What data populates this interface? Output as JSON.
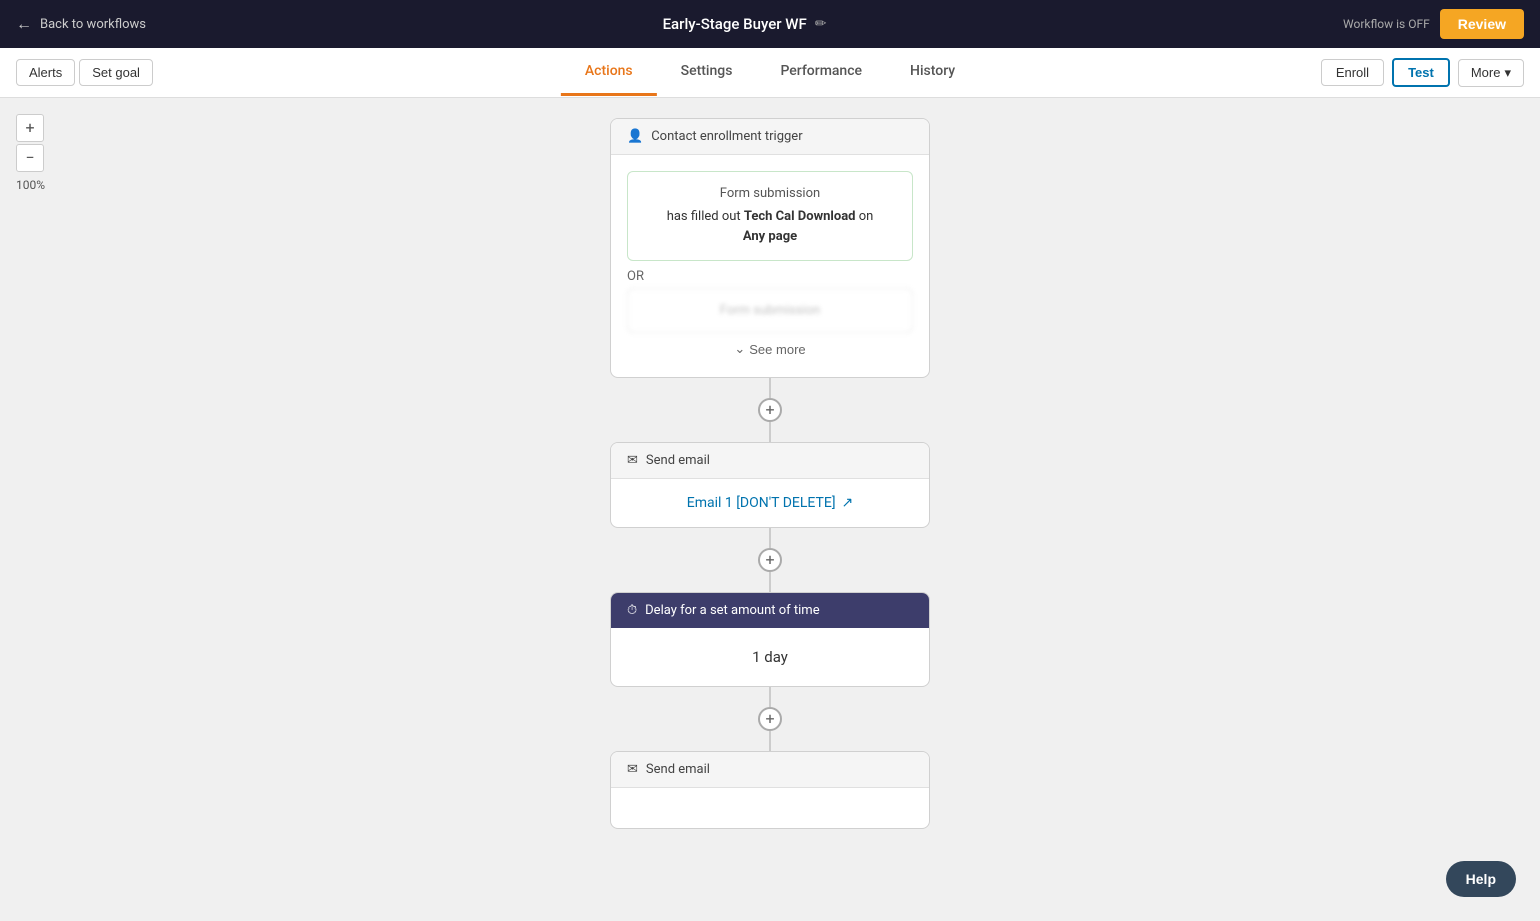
{
  "topbar": {
    "back_label": "Back to workflows",
    "workflow_name": "Early-Stage Buyer WF",
    "status": "Workflow is OFF",
    "review_label": "Review"
  },
  "navbar": {
    "alerts_label": "Alerts",
    "set_goal_label": "Set goal",
    "tabs": [
      {
        "id": "actions",
        "label": "Actions",
        "active": true
      },
      {
        "id": "settings",
        "label": "Settings",
        "active": false
      },
      {
        "id": "performance",
        "label": "Performance",
        "active": false
      },
      {
        "id": "history",
        "label": "History",
        "active": false
      }
    ],
    "enroll_label": "Enroll",
    "test_label": "Test",
    "more_label": "More"
  },
  "canvas": {
    "zoom_level": "100%",
    "zoom_in_label": "+",
    "zoom_out_label": "−"
  },
  "trigger_block": {
    "header": "Contact enrollment trigger",
    "form_submission": {
      "title": "Form submission",
      "desc_prefix": "has filled out ",
      "form_name": "Tech Cal Download",
      "desc_suffix": " on",
      "page_label": "Any page"
    },
    "or_label": "OR",
    "blurred_title": "Form submission",
    "see_more_label": "See more"
  },
  "send_email_block_1": {
    "header": "Send email",
    "email_link_text": "Email 1 [DON'T DELETE]"
  },
  "delay_block": {
    "header": "Delay for a set amount of time",
    "value": "1 day"
  },
  "send_email_block_2": {
    "header": "Send email"
  },
  "help_button": {
    "label": "Help"
  },
  "icons": {
    "back_arrow": "←",
    "edit": "✏",
    "contact": "👤",
    "envelope": "✉",
    "clock": "⏱",
    "chevron_down": "⌄",
    "external_link": "↗",
    "more_chevron": "▾",
    "plus": "+"
  }
}
